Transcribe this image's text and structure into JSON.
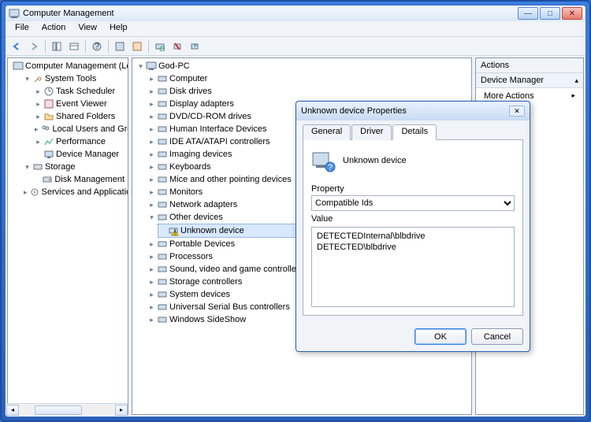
{
  "window": {
    "title": "Computer Management",
    "menu": [
      "File",
      "Action",
      "View",
      "Help"
    ]
  },
  "left_tree": {
    "root": "Computer Management (Local",
    "system_tools": {
      "label": "System Tools",
      "children": [
        "Task Scheduler",
        "Event Viewer",
        "Shared Folders",
        "Local Users and Groups",
        "Performance",
        "Device Manager"
      ]
    },
    "storage": {
      "label": "Storage",
      "children": [
        "Disk Management"
      ]
    },
    "services": "Services and Applications"
  },
  "mid_tree": {
    "root": "God-PC",
    "items": [
      "Computer",
      "Disk drives",
      "Display adapters",
      "DVD/CD-ROM drives",
      "Human Interface Devices",
      "IDE ATA/ATAPI controllers",
      "Imaging devices",
      "Keyboards",
      "Mice and other pointing devices",
      "Monitors",
      "Network adapters"
    ],
    "other_devices": {
      "label": "Other devices",
      "children": [
        "Unknown device"
      ]
    },
    "items2": [
      "Portable Devices",
      "Processors",
      "Sound, video and game controllers",
      "Storage controllers",
      "System devices",
      "Universal Serial Bus controllers",
      "Windows SideShow"
    ]
  },
  "actions": {
    "header": "Actions",
    "section": "Device Manager",
    "more": "More Actions"
  },
  "dialog": {
    "title": "Unknown device Properties",
    "tabs": [
      "General",
      "Driver",
      "Details"
    ],
    "device_name": "Unknown device",
    "property_label": "Property",
    "property_selected": "Compatible Ids",
    "value_label": "Value",
    "values": [
      "DETECTEDInternal\\blbdrive",
      "DETECTED\\blbdrive"
    ],
    "ok": "OK",
    "cancel": "Cancel"
  }
}
